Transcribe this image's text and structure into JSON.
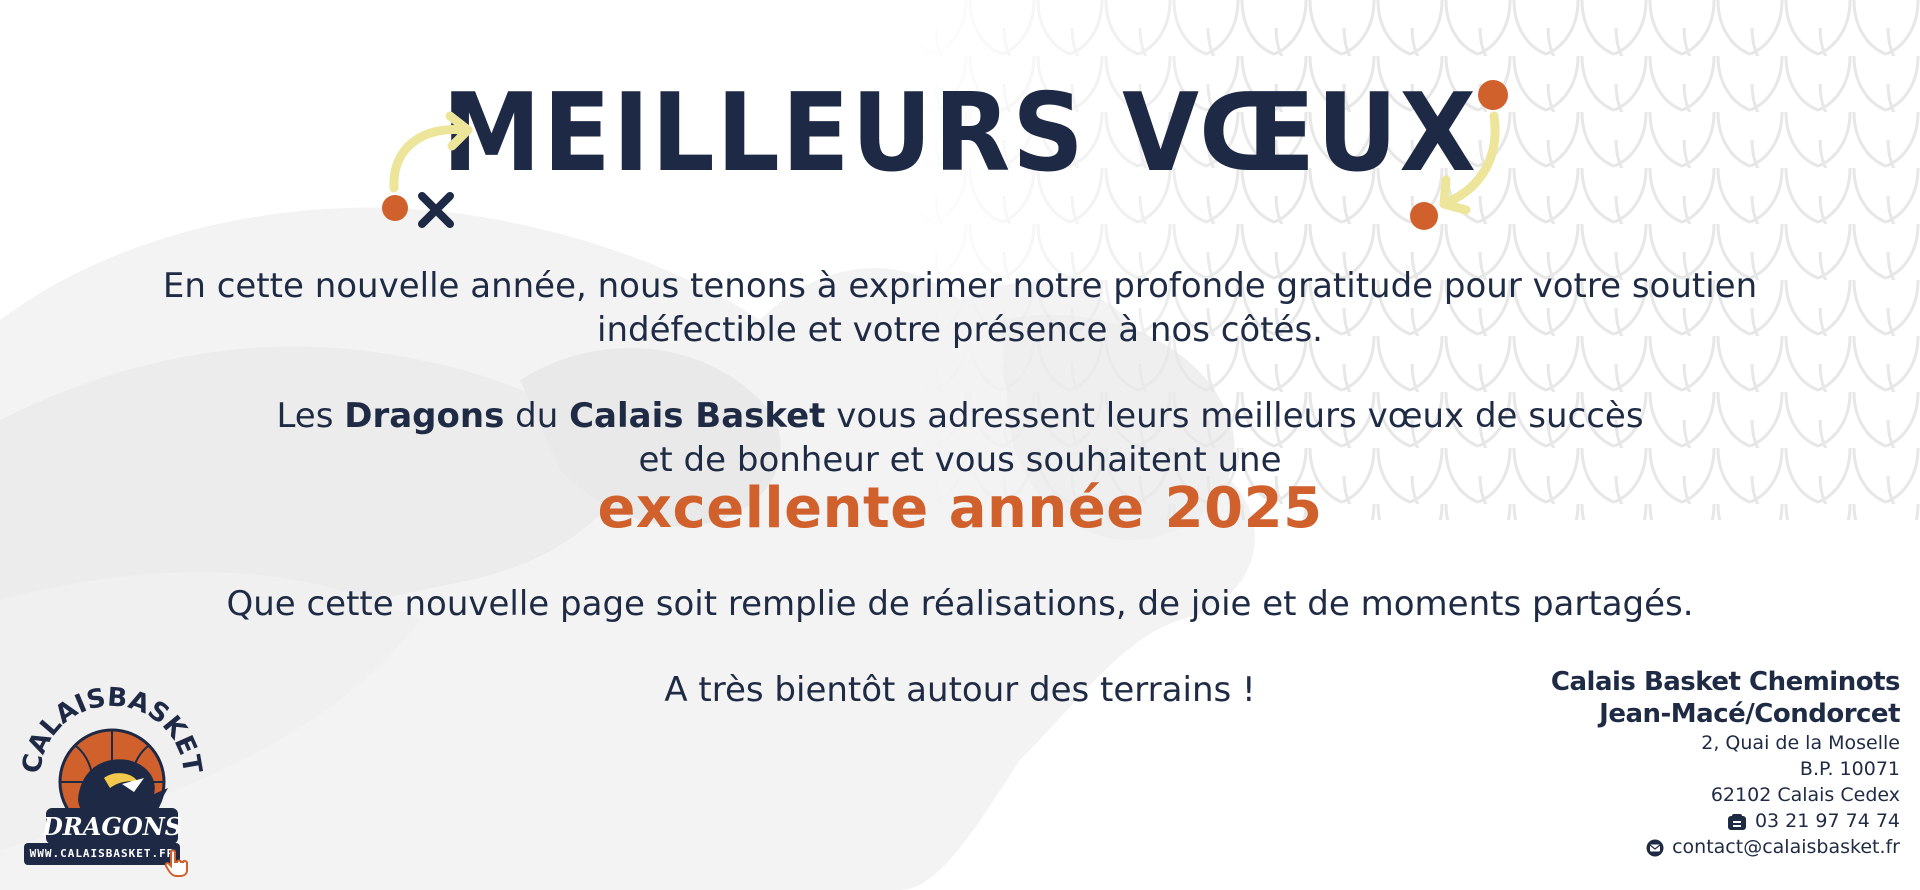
{
  "heading": {
    "title": "MEILLEURS VŒUX"
  },
  "message": {
    "p1_line1": "En cette nouvelle année, nous tenons à exprimer notre profonde gratitude pour votre soutien",
    "p1_line2": "indéfectible et votre présence à nos côtés.",
    "p2_les": "Les",
    "p2_dragons": "Dragons",
    "p2_du": "du",
    "p2_club": "Calais Basket",
    "p2_rest": "vous adressent leurs meilleurs vœux de succès",
    "p2_line2": "et de bonheur et vous souhaitent une",
    "highlight": "excellente année 2025",
    "p3": "Que cette nouvelle page soit remplie de réalisations, de joie et de moments partagés.",
    "p4": "A très bientôt autour des terrains !"
  },
  "logo": {
    "arc_text": "CALAISBASKET",
    "team": "DRAGONS",
    "website": "WWW.CALAISBASKET.FR"
  },
  "contact": {
    "org_line1": "Calais Basket Cheminots",
    "org_line2": "Jean-Macé/Condorcet",
    "address1": "2, Quai de la Moselle",
    "address2": "B.P. 10071",
    "address3": "62102 Calais Cedex",
    "phone": "03 21 97 74 74",
    "email": "contact@calaisbasket.fr"
  },
  "colors": {
    "navy": "#1e2a45",
    "orange": "#d0602c",
    "yellow": "#ece59a",
    "watermark": "#f1f1f1"
  },
  "icons": [
    "arrow-curve-icon",
    "cross-icon",
    "dot-icon",
    "phone-icon",
    "mail-icon",
    "cursor-hand-icon",
    "basketball-icon",
    "dragon-icon"
  ]
}
